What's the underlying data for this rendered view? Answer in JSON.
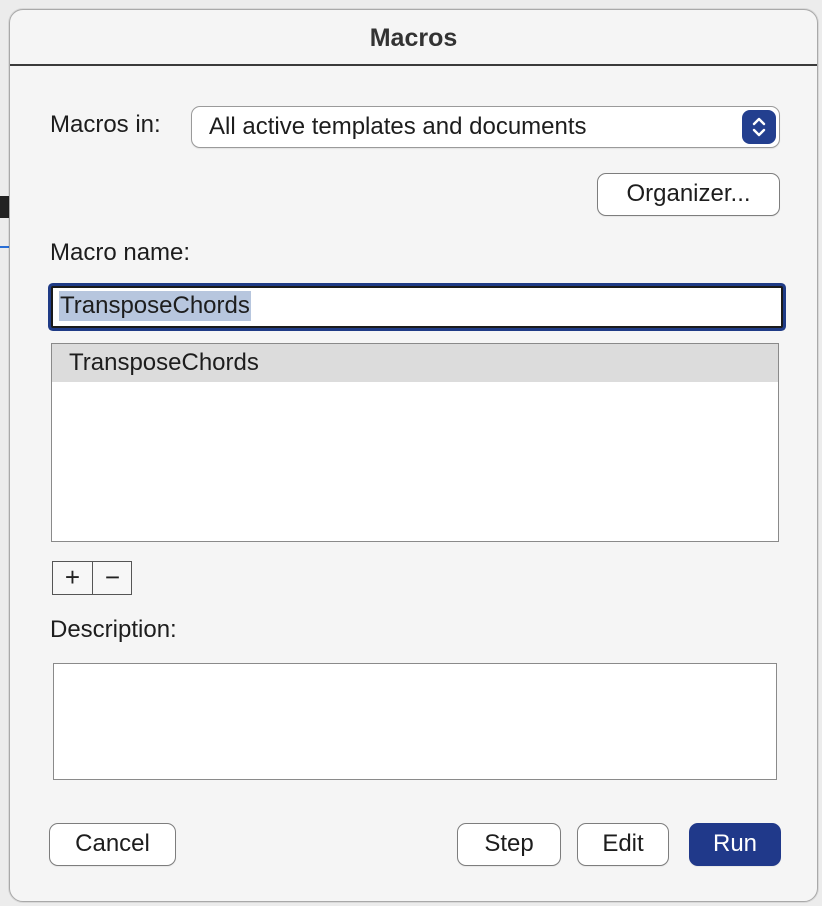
{
  "dialog": {
    "title": "Macros"
  },
  "macros_in": {
    "label": "Macros in:",
    "selected": "All active templates and documents"
  },
  "buttons": {
    "organizer": "Organizer...",
    "cancel": "Cancel",
    "step": "Step",
    "edit": "Edit",
    "run": "Run",
    "add": "+",
    "remove": "−"
  },
  "macro_name": {
    "label": "Macro name:",
    "value": "TransposeChords"
  },
  "macro_list": {
    "items": [
      "TransposeChords"
    ]
  },
  "description": {
    "label": "Description:",
    "value": ""
  },
  "colors": {
    "accent": "#20398a",
    "selection": "#b7c6de",
    "list_selected": "#dcdcdc"
  }
}
